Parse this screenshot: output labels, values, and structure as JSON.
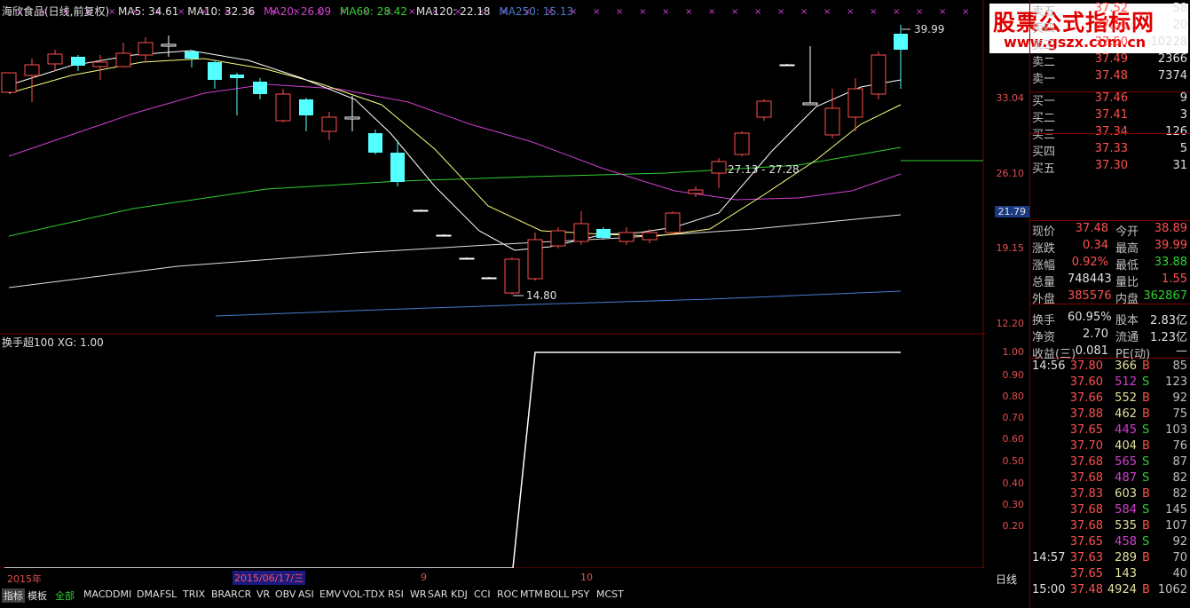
{
  "legend": {
    "title": "海欣食品(日线,前复权)",
    "ma5": "MA5: 34.61",
    "ma10": "MA10: 32.36",
    "ma20": "MA20: 26.09",
    "ma60": "MA60: 28.42",
    "ma120": "MA120: 22.18",
    "ma250": "MA250: 15.13"
  },
  "colors": {
    "ma5": "#ffffff",
    "ma10": "#ffff00",
    "ma20": "#ff00ff",
    "ma60": "#00ff00",
    "ma120": "#ffffff",
    "ma250": "#4a7bd0",
    "up": "#ff5050",
    "down": "#54ffff"
  },
  "price_axis": {
    "labels": [
      "33.04",
      "26.10",
      "21.79",
      "19.15",
      "12.20"
    ],
    "indicator_labels": [
      "1.00",
      "0.90",
      "0.80",
      "0.70",
      "0.60",
      "0.50",
      "0.40",
      "0.30",
      "0.20"
    ]
  },
  "annotations": {
    "high": "39.99",
    "low": "14.80",
    "range": "27.13 - 27.28"
  },
  "indicator": {
    "legend": "换手超100 XG: 1.00"
  },
  "date_bar": {
    "year": "2015年",
    "current": "2015/06/17/三",
    "m9": "9",
    "m10": "10"
  },
  "panel_tag": "日线",
  "tabs": [
    "指标",
    "模板",
    "全部",
    "MACD",
    "DMI",
    "DMA",
    "FSL",
    "TRIX",
    "BRAR",
    "CR",
    "VR",
    "OBV",
    "ASI",
    "EMV",
    "VOL-TDX",
    "RSI",
    "WR",
    "SAR",
    "KDJ",
    "CCI",
    "ROC",
    "MTM",
    "BOLL",
    "PSY",
    "MCST"
  ],
  "watermark": {
    "line1": "股票公式指标网",
    "line2": "www.gszx.com.cn"
  },
  "orderbook": [
    {
      "label": "卖五",
      "price": "37.52",
      "vol": "58"
    },
    {
      "label": "卖四",
      "price": "37.51",
      "vol": "20"
    },
    {
      "label": "卖三",
      "price": "37.50",
      "vol": "10228"
    },
    {
      "label": "卖二",
      "price": "37.49",
      "vol": "2366"
    },
    {
      "label": "卖一",
      "price": "37.48",
      "vol": "7374"
    },
    {
      "label": "买一",
      "price": "37.46",
      "vol": "9"
    },
    {
      "label": "买二",
      "price": "37.41",
      "vol": "3"
    },
    {
      "label": "买三",
      "price": "37.34",
      "vol": "126"
    },
    {
      "label": "买四",
      "price": "37.33",
      "vol": "5"
    },
    {
      "label": "买五",
      "price": "37.30",
      "vol": "31"
    }
  ],
  "quote": [
    {
      "a": "现价",
      "b": "37.48",
      "c": "今开",
      "d": "38.89"
    },
    {
      "a": "涨跌",
      "b": "0.34",
      "c": "最高",
      "d": "39.99"
    },
    {
      "a": "涨幅",
      "b": "0.92%",
      "c": "最低",
      "d": "33.88"
    },
    {
      "a": "总量",
      "b": "748443",
      "c": "量比",
      "d": "1.55"
    },
    {
      "a": "外盘",
      "b": "385576",
      "c": "内盘",
      "d": "362867"
    },
    {
      "a": "换手",
      "b": "60.95%",
      "c": "股本",
      "d": "2.83亿"
    },
    {
      "a": "净资",
      "b": "2.70",
      "c": "流通",
      "d": "1.23亿"
    },
    {
      "a": "收益(三)",
      "b": "0.081",
      "c": "PE(动)",
      "d": "—"
    }
  ],
  "ticks": [
    {
      "t": "14:56",
      "p": "37.80",
      "v": "366",
      "bs": "B",
      "n": "85"
    },
    {
      "t": "",
      "p": "37.60",
      "v": "512",
      "bs": "S",
      "n": "123"
    },
    {
      "t": "",
      "p": "37.66",
      "v": "552",
      "bs": "B",
      "n": "92"
    },
    {
      "t": "",
      "p": "37.88",
      "v": "462",
      "bs": "B",
      "n": "75"
    },
    {
      "t": "",
      "p": "37.65",
      "v": "445",
      "bs": "S",
      "n": "103"
    },
    {
      "t": "",
      "p": "37.70",
      "v": "404",
      "bs": "B",
      "n": "76"
    },
    {
      "t": "",
      "p": "37.68",
      "v": "565",
      "bs": "S",
      "n": "87"
    },
    {
      "t": "",
      "p": "37.68",
      "v": "487",
      "bs": "S",
      "n": "82"
    },
    {
      "t": "",
      "p": "37.83",
      "v": "603",
      "bs": "B",
      "n": "82"
    },
    {
      "t": "",
      "p": "37.68",
      "v": "584",
      "bs": "S",
      "n": "145"
    },
    {
      "t": "",
      "p": "37.68",
      "v": "535",
      "bs": "B",
      "n": "107"
    },
    {
      "t": "",
      "p": "37.65",
      "v": "458",
      "bs": "S",
      "n": "92"
    },
    {
      "t": "14:57",
      "p": "37.63",
      "v": "289",
      "bs": "B",
      "n": "70"
    },
    {
      "t": "",
      "p": "37.65",
      "v": "143",
      "bs": "",
      "n": "40"
    },
    {
      "t": "15:00",
      "p": "37.48",
      "v": "4924",
      "bs": "B",
      "n": "1062"
    }
  ]
}
